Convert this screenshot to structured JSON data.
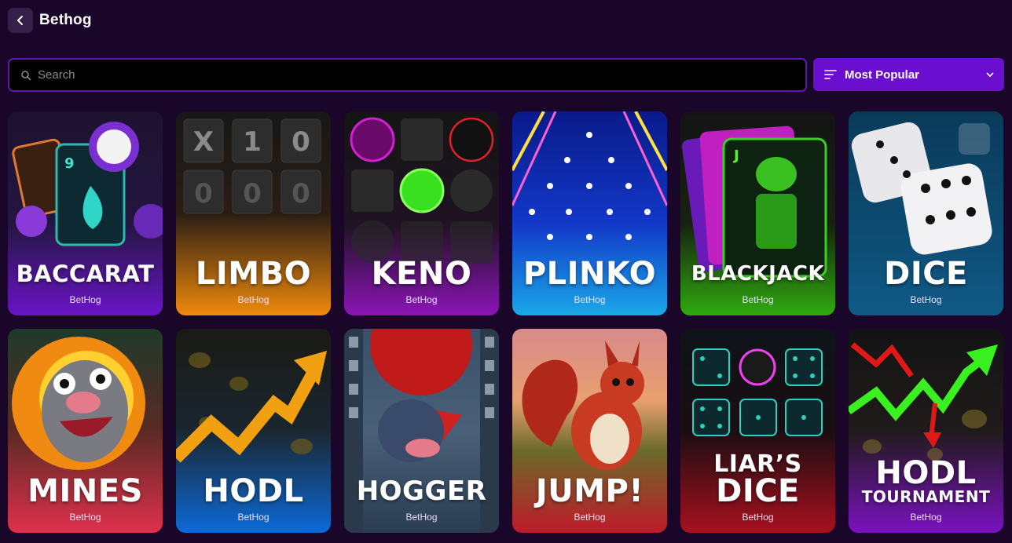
{
  "header": {
    "title": "Bethog",
    "back_icon": "chevron-left-icon"
  },
  "search": {
    "placeholder": "Search",
    "value": "",
    "icon": "search-icon"
  },
  "sort": {
    "selected": "Most Popular",
    "icon": "sort-lines-icon",
    "chevron": "chevron-down-icon"
  },
  "games": [
    {
      "title": "BACCARAT",
      "provider": "BetHog",
      "color": "#6a14c8"
    },
    {
      "title": "LIMBO",
      "provider": "BetHog",
      "color": "#f08a0c"
    },
    {
      "title": "KENO",
      "provider": "BetHog",
      "color": "#8b14b8"
    },
    {
      "title": "PLINKO",
      "provider": "BetHog",
      "color": "#1aa8e8"
    },
    {
      "title": "BLACKJACK",
      "provider": "BetHog",
      "color": "#2faa0f"
    },
    {
      "title": "DICE",
      "provider": "BetHog",
      "color": "#0f5a86"
    },
    {
      "title": "MINES",
      "provider": "BetHog",
      "color": "#e0304c"
    },
    {
      "title": "HODL",
      "provider": "BetHog",
      "color": "#0c6ad8"
    },
    {
      "title": "HOGGER",
      "provider": "BetHog",
      "color": "#2a3d52"
    },
    {
      "title": "JUMP!",
      "provider": "BetHog",
      "color": "#c01a2a"
    },
    {
      "title": "LIAR’S",
      "title2": "DICE",
      "provider": "BetHog",
      "color": "#a8101e"
    },
    {
      "title": "HODL",
      "title2": "TOURNAMENT",
      "provider": "BetHog",
      "color": "#7a12c0"
    }
  ]
}
